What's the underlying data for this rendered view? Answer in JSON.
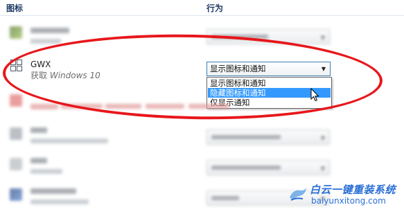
{
  "columns": {
    "icon_label": "图标",
    "behavior_label": "行为"
  },
  "gwx": {
    "name": "GWX",
    "desc_cn": "获取",
    "desc_en": "Windows 10",
    "combo_value": "显示图标和通知",
    "options": [
      "显示图标和通知",
      "隐藏图标和通知",
      "仅显示通知"
    ],
    "selected_option": "隐藏图标和通知"
  },
  "colors": {
    "highlight_ellipse": "#e7171b",
    "selection": "#3399ff",
    "watermark": "#2a6fd6"
  },
  "watermark": {
    "title": "白云一键重装系统",
    "url": "baiyunxitong.com"
  }
}
